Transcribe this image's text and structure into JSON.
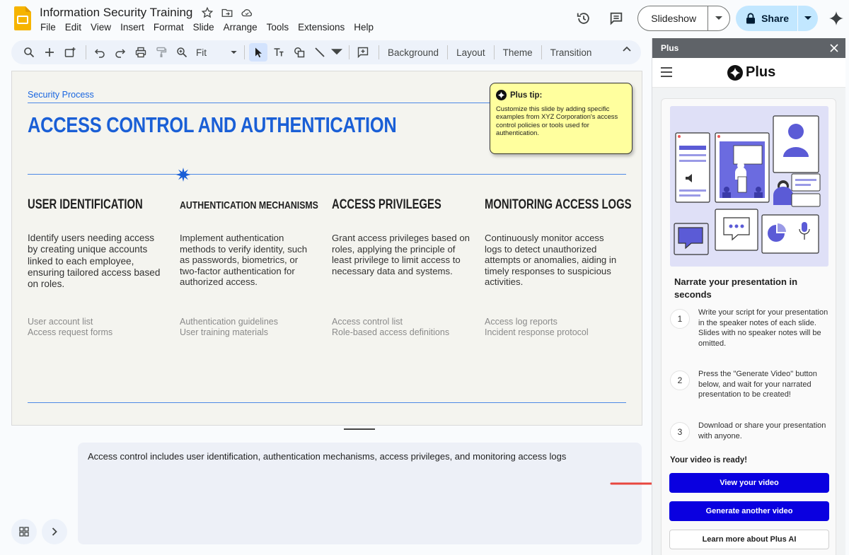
{
  "document": {
    "title": "Information Security Training",
    "menu": [
      "File",
      "Edit",
      "View",
      "Insert",
      "Format",
      "Slide",
      "Arrange",
      "Tools",
      "Extensions",
      "Help"
    ]
  },
  "header": {
    "slideshow_label": "Slideshow",
    "share_label": "Share"
  },
  "toolbar": {
    "zoom_value": "Fit",
    "background_label": "Background",
    "layout_label": "Layout",
    "theme_label": "Theme",
    "transition_label": "Transition"
  },
  "slide": {
    "subtitle": "Security Process",
    "title": "ACCESS CONTROL AND AUTHENTICATION",
    "columns": [
      {
        "heading": "USER IDENTIFICATION",
        "body": "Identify users needing access by creating unique accounts linked to each employee, ensuring tailored access based on roles.",
        "refs": [
          "User account list",
          "Access request forms"
        ]
      },
      {
        "heading": "AUTHENTICATION MECHANISMS",
        "body": "Implement authentication methods to verify identity, such as passwords, biometrics, or two-factor authentication for authorized access.",
        "refs": [
          "Authentication guidelines",
          "User training materials"
        ]
      },
      {
        "heading": "ACCESS PRIVILEGES",
        "body": "Grant access privileges based on roles, applying the principle of least privilege to limit access to necessary data and systems.",
        "refs": [
          "Access control list",
          "Role-based access definitions"
        ]
      },
      {
        "heading": "MONITORING ACCESS LOGS",
        "body": "Continuously monitor access logs to detect unauthorized attempts or anomalies, aiding in timely responses to suspicious activities.",
        "refs": [
          "Access log reports",
          "Incident response protocol"
        ]
      }
    ],
    "tip": {
      "heading": "Plus tip:",
      "body": "Customize this slide by adding specific examples from XYZ Corporation's access control policies or tools used for authentication."
    }
  },
  "notes": {
    "text": "Access control includes user identification, authentication mechanisms, access privileges, and monitoring access logs"
  },
  "panel": {
    "header_title": "Plus",
    "brand_name": "Plus",
    "narrate_title": "Narrate your presentation in seconds",
    "steps": [
      {
        "num": "1",
        "text": "Write your script for your presentation in the speaker notes of each slide. Slides with no speaker notes will be omitted."
      },
      {
        "num": "2",
        "text": "Press the \"Generate Video\" button below, and wait for your narrated presentation to be created!"
      },
      {
        "num": "3",
        "text": "Download or share your presentation with anyone."
      }
    ],
    "ready_text": "Your video is ready!",
    "view_video_label": "View your video",
    "generate_another_label": "Generate another video",
    "learn_more_label": "Learn more about Plus AI"
  },
  "colors": {
    "accent_blue": "#1a5fd6",
    "panel_button": "#0a00e0",
    "share_button": "#c2e7ff",
    "tip_background": "#ffff9e",
    "arrow": "#e8473f"
  }
}
